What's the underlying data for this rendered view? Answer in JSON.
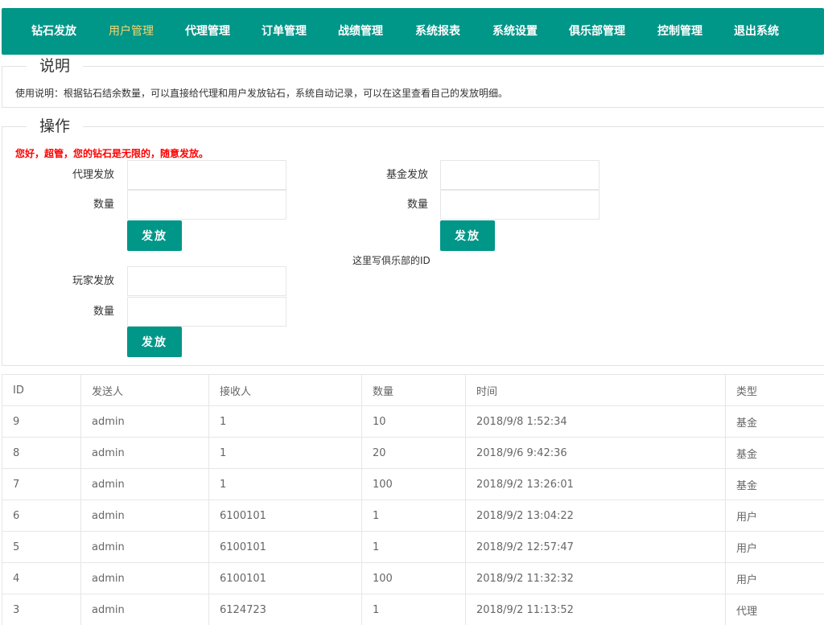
{
  "nav": {
    "items": [
      {
        "label": "钻石发放",
        "active": false
      },
      {
        "label": "用户管理",
        "active": true
      },
      {
        "label": "代理管理",
        "active": false
      },
      {
        "label": "订单管理",
        "active": false
      },
      {
        "label": "战绩管理",
        "active": false
      },
      {
        "label": "系统报表",
        "active": false
      },
      {
        "label": "系统设置",
        "active": false
      },
      {
        "label": "俱乐部管理",
        "active": false
      },
      {
        "label": "控制管理",
        "active": false
      },
      {
        "label": "退出系统",
        "active": false
      }
    ]
  },
  "description": {
    "legend": "说明",
    "text": "使用说明：根据钻石结余数量，可以直接给代理和用户发放钻石，系统自动记录，可以在这里查看自己的发放明细。"
  },
  "operation": {
    "legend": "操作",
    "notice": "您好，超管，您的钻石是无限的，随意发放。",
    "agent": {
      "label": "代理发放",
      "qty_label": "数量",
      "button": "发放",
      "value": "",
      "qty_value": ""
    },
    "fund": {
      "label": "基金发放",
      "qty_label": "数量",
      "button": "发放",
      "value": "",
      "qty_value": "",
      "hint": "这里写俱乐部的ID"
    },
    "player": {
      "label": "玩家发放",
      "qty_label": "数量",
      "button": "发放",
      "value": "",
      "qty_value": ""
    }
  },
  "table": {
    "headers": [
      "ID",
      "发送人",
      "接收人",
      "数量",
      "时间",
      "类型"
    ],
    "rows": [
      [
        "9",
        "admin",
        "1",
        "10",
        "2018/9/8 1:52:34",
        "基金"
      ],
      [
        "8",
        "admin",
        "1",
        "20",
        "2018/9/6 9:42:36",
        "基金"
      ],
      [
        "7",
        "admin",
        "1",
        "100",
        "2018/9/2 13:26:01",
        "基金"
      ],
      [
        "6",
        "admin",
        "6100101",
        "1",
        "2018/9/2 13:04:22",
        "用户"
      ],
      [
        "5",
        "admin",
        "6100101",
        "1",
        "2018/9/2 12:57:47",
        "用户"
      ],
      [
        "4",
        "admin",
        "6100101",
        "100",
        "2018/9/2 11:32:32",
        "用户"
      ],
      [
        "3",
        "admin",
        "6124723",
        "1",
        "2018/9/2 11:13:52",
        "代理"
      ]
    ]
  },
  "colors": {
    "primary": "#009688",
    "active_nav": "#f5d76e",
    "notice": "#ff0000"
  }
}
